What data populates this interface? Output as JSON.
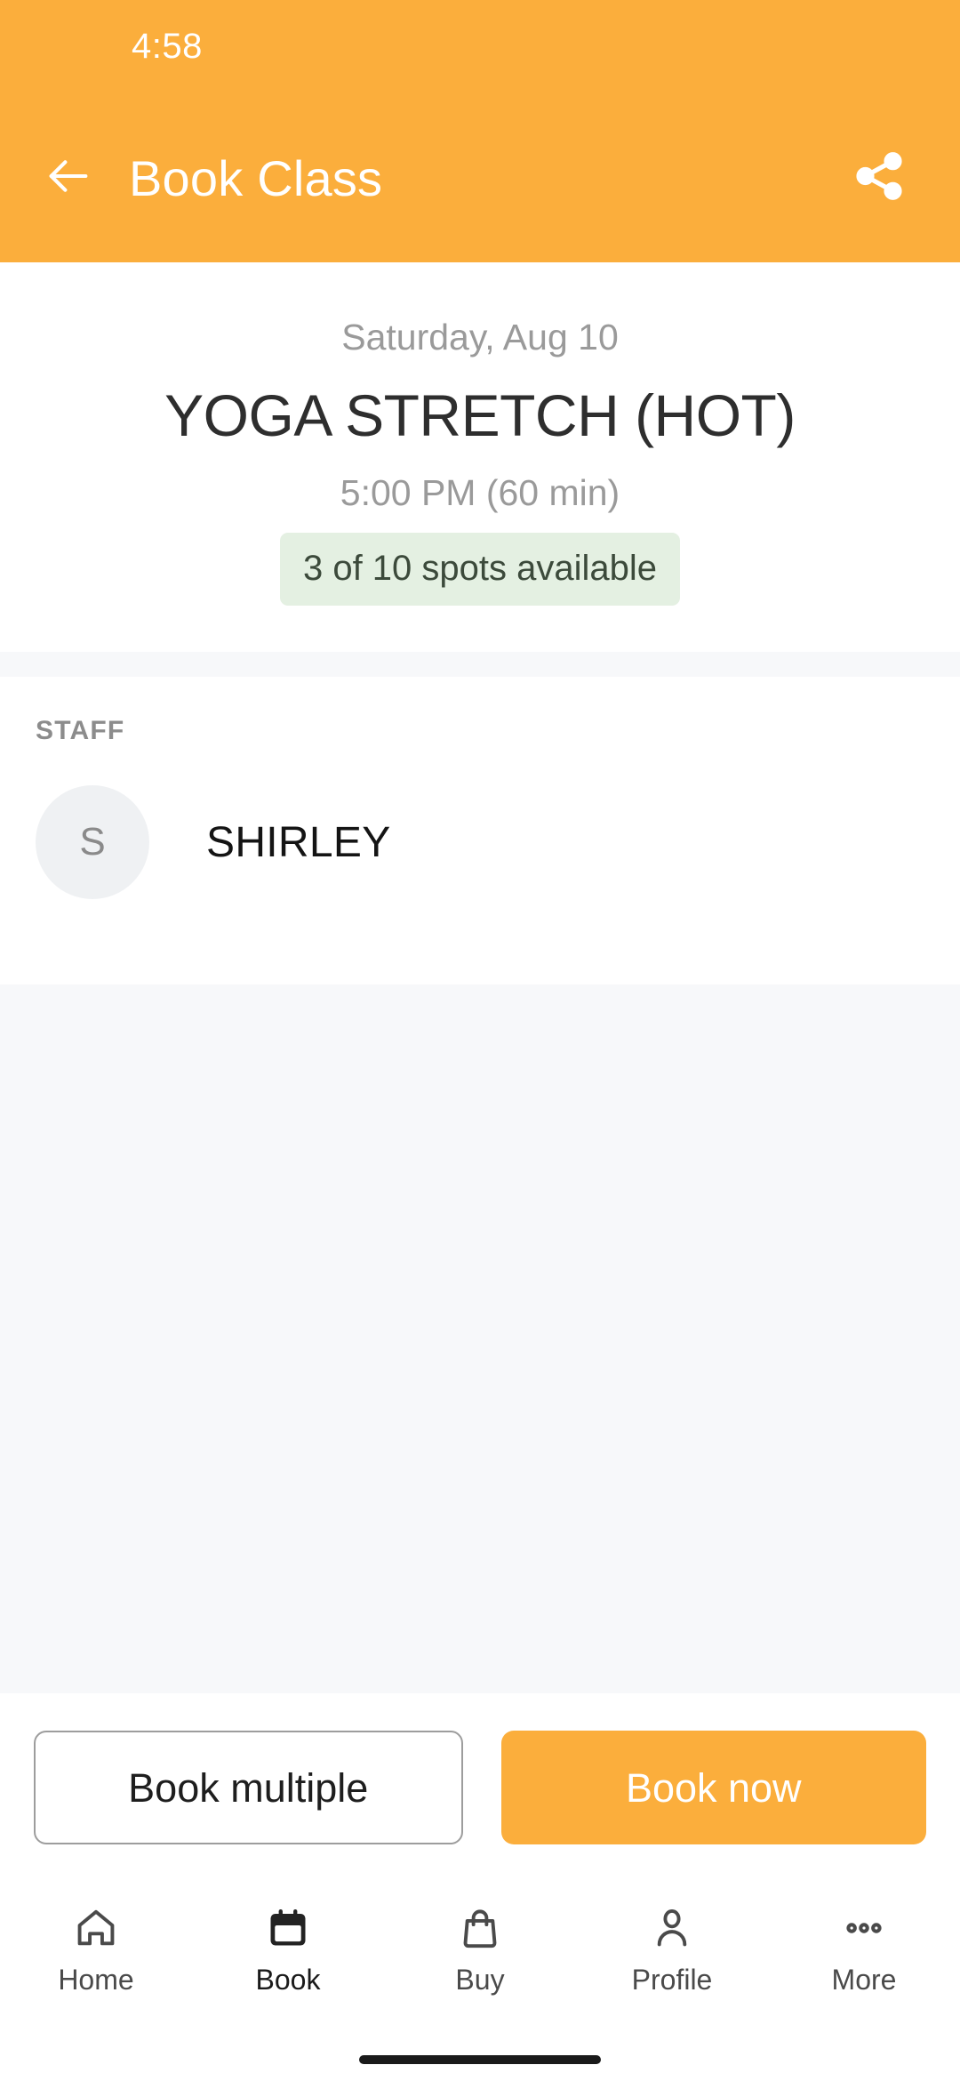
{
  "statusbar": {
    "time": "4:58"
  },
  "appbar": {
    "title": "Book Class",
    "back_icon": "arrow-left-icon",
    "share_icon": "share-icon",
    "background_color": "#FBAE3C",
    "text_color": "#FFFFFF"
  },
  "class": {
    "date": "Saturday, Aug 10",
    "name": "YOGA STRETCH (HOT)",
    "time": "5:00 PM (60 min)",
    "spots_text": "3 of 10 spots available",
    "spots_available": 3,
    "spots_total": 10,
    "spots_badge_bg": "#E4F0E2",
    "spots_badge_color": "#3C4A3B"
  },
  "staff": {
    "section_label": "STAFF",
    "members": [
      {
        "initial": "S",
        "name": "SHIRLEY"
      }
    ]
  },
  "actions": {
    "secondary_label": "Book multiple",
    "primary_label": "Book now",
    "primary_color": "#FBAE3C"
  },
  "bottom_nav": {
    "items": [
      {
        "label": "Home",
        "icon": "home-icon",
        "active": false
      },
      {
        "label": "Book",
        "icon": "calendar-icon",
        "active": true
      },
      {
        "label": "Buy",
        "icon": "bag-icon",
        "active": false
      },
      {
        "label": "Profile",
        "icon": "person-icon",
        "active": false
      },
      {
        "label": "More",
        "icon": "more-dots-icon",
        "active": false
      }
    ]
  }
}
